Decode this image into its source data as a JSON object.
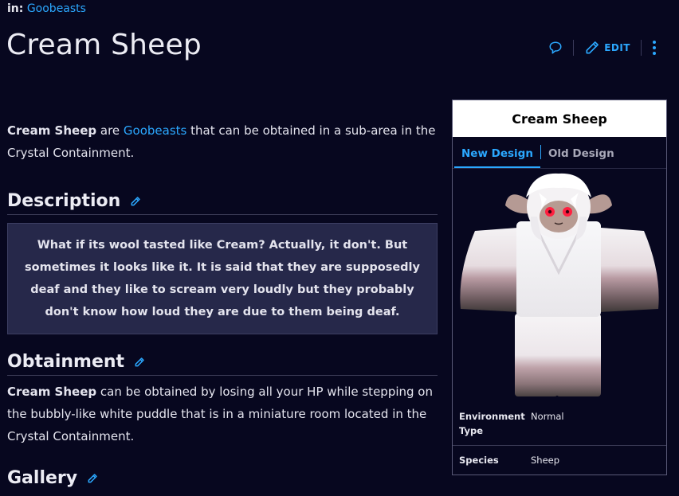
{
  "breadcrumb": {
    "prefix": "in:",
    "link": "Goobeasts"
  },
  "page": {
    "title": "Cream Sheep"
  },
  "actions": {
    "edit_label": "EDIT"
  },
  "intro": {
    "bold": "Cream Sheep",
    "t1": " are ",
    "link": "Goobeasts",
    "t2": " that can be obtained in a sub-area in the Crystal Containment."
  },
  "description": {
    "heading": "Description",
    "quote": "What if its wool tasted like Cream? Actually, it don't. But sometimes it looks like it. It is said that they are supposedly deaf and they like to scream very loudly but they probably don't know how loud they are due to them being deaf."
  },
  "obtainment": {
    "heading": "Obtainment",
    "bold": "Cream Sheep",
    "text": " can be obtained by losing all your HP while stepping on the bubbly-like white puddle that is in a miniature room located in the Crystal Containment."
  },
  "gallery": {
    "heading": "Gallery"
  },
  "infobox": {
    "title": "Cream Sheep",
    "tabs": [
      "New Design",
      "Old Design"
    ],
    "rows": [
      {
        "key": "Environment Type",
        "value": "Normal"
      },
      {
        "key": "Species",
        "value": "Sheep"
      }
    ]
  },
  "colors": {
    "accent": "#2ba8ff",
    "background": "#07071f",
    "quote_bg": "#26284a"
  }
}
